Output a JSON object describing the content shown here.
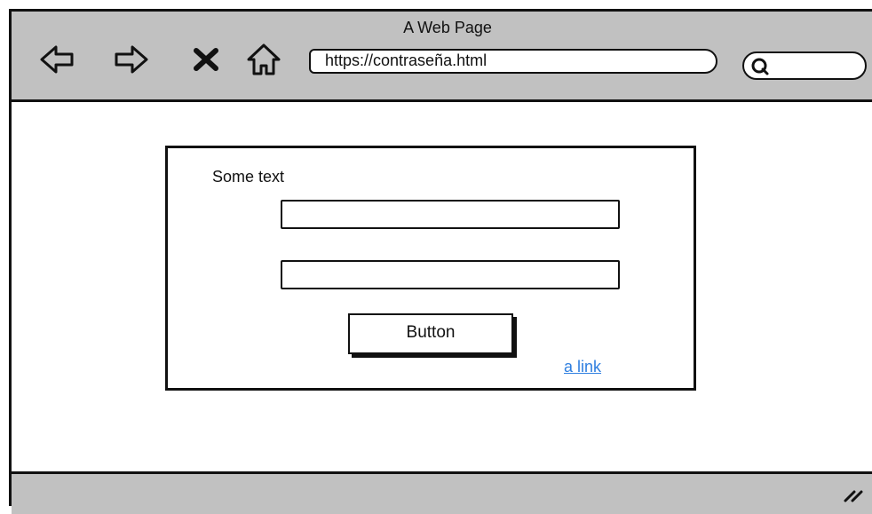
{
  "window": {
    "title": "A Web Page"
  },
  "toolbar": {
    "back_icon": "back-arrow-icon",
    "forward_icon": "forward-arrow-icon",
    "stop_icon": "close-icon",
    "home_icon": "home-icon",
    "url": "https://contraseña.html",
    "search_icon": "search-icon"
  },
  "form": {
    "label": "Some text",
    "field_1_value": "",
    "field_2_value": "",
    "button_label": "Button",
    "link_text": "a link"
  },
  "colors": {
    "chrome": "#c1c1c1",
    "link": "#2f7fe0",
    "border": "#111111"
  }
}
